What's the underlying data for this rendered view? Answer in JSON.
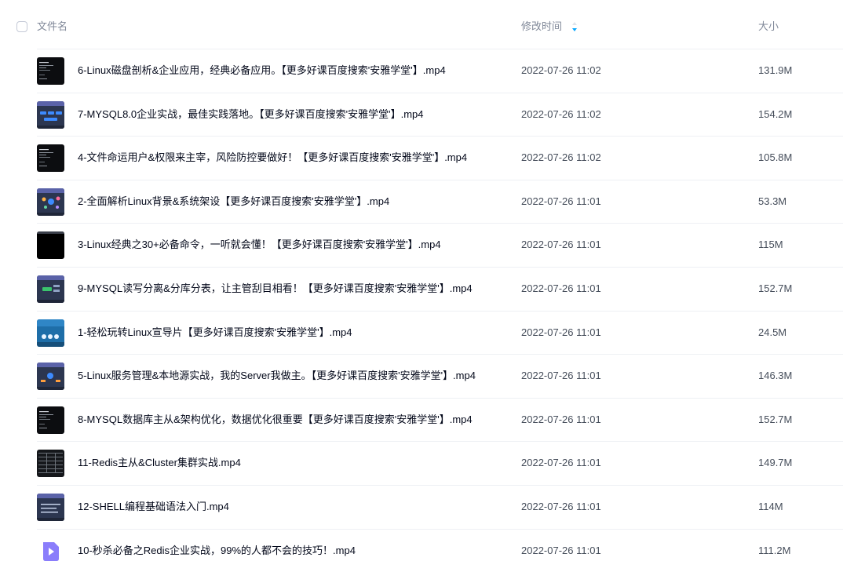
{
  "header": {
    "name_label": "文件名",
    "time_label": "修改时间",
    "size_label": "大小",
    "sort_icon": "sort-desc-icon"
  },
  "colors": {
    "accent": "#06a7ff",
    "text_primary": "#03081a",
    "text_secondary": "#818999",
    "divider": "#eef0f4",
    "video_icon": "#8a7dfb"
  },
  "files": [
    {
      "name": "6-Linux磁盘剖析&企业应用，经典必备应用。【更多好课百度搜索'安雅学堂'】.mp4",
      "time": "2022-07-26 11:02",
      "size": "131.9M",
      "thumb": "terminal"
    },
    {
      "name": "7-MYSQL8.0企业实战，最佳实践落地。【更多好课百度搜索'安雅学堂'】.mp4",
      "time": "2022-07-26 11:02",
      "size": "154.2M",
      "thumb": "slide"
    },
    {
      "name": "4-文件命运用户&权限来主宰，风险防控要做好！【更多好课百度搜索'安雅学堂'】.mp4",
      "time": "2022-07-26 11:02",
      "size": "105.8M",
      "thumb": "terminal"
    },
    {
      "name": "2-全面解析Linux背景&系统架设【更多好课百度搜索'安雅学堂'】.mp4",
      "time": "2022-07-26 11:01",
      "size": "53.3M",
      "thumb": "slide-dots"
    },
    {
      "name": "3-Linux经典之30+必备命令，一听就会懂！【更多好课百度搜索'安雅学堂'】.mp4",
      "time": "2022-07-26 11:01",
      "size": "115M",
      "thumb": "dark"
    },
    {
      "name": "9-MYSQL读写分离&分库分表，让主管刮目相看！【更多好课百度搜索'安雅学堂'】.mp4",
      "time": "2022-07-26 11:01",
      "size": "152.7M",
      "thumb": "slide-green"
    },
    {
      "name": "1-轻松玩转Linux宣导片【更多好课百度搜索'安雅学堂'】.mp4",
      "time": "2022-07-26 11:01",
      "size": "24.5M",
      "thumb": "promo"
    },
    {
      "name": "5-Linux服务管理&本地源实战，我的Server我做主。【更多好课百度搜索'安雅学堂'】.mp4",
      "time": "2022-07-26 11:01",
      "size": "146.3M",
      "thumb": "slide-orange"
    },
    {
      "name": "8-MYSQL数据库主从&架构优化，数据优化很重要【更多好课百度搜索'安雅学堂'】.mp4",
      "time": "2022-07-26 11:01",
      "size": "152.7M",
      "thumb": "terminal"
    },
    {
      "name": "11-Redis主从&Cluster集群实战.mp4",
      "time": "2022-07-26 11:01",
      "size": "149.7M",
      "thumb": "table"
    },
    {
      "name": "12-SHELL编程基础语法入门.mp4",
      "time": "2022-07-26 11:01",
      "size": "114M",
      "thumb": "slide-lines"
    },
    {
      "name": "10-秒杀必备之Redis企业实战，99%的人都不会的技巧！.mp4",
      "time": "2022-07-26 11:01",
      "size": "111.2M",
      "thumb": "video-icon"
    }
  ]
}
